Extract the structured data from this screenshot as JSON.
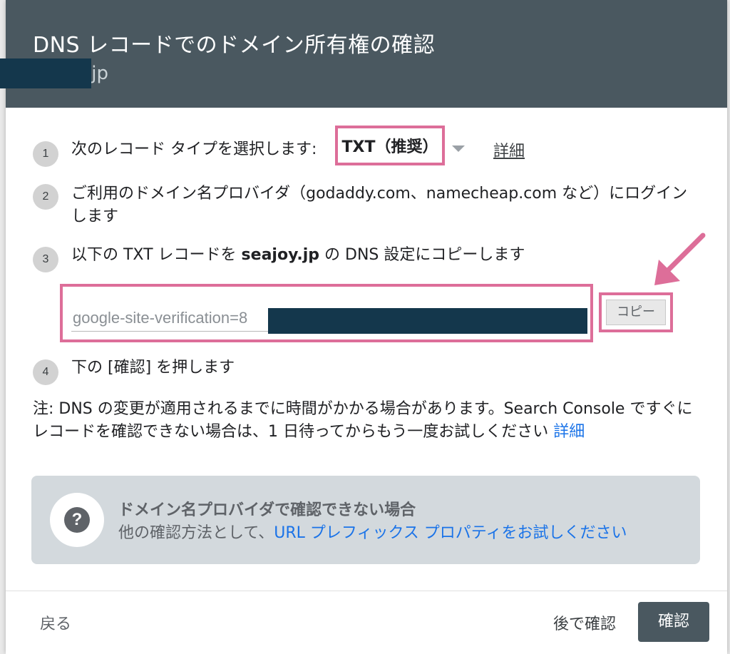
{
  "header": {
    "title": "DNS レコードでのドメイン所有権の確認",
    "domain_suffix": ".jp"
  },
  "steps": [
    {
      "number": "1",
      "text": "次のレコード タイプを選択します:"
    },
    {
      "number": "2",
      "text_line1": "ご利用のドメイン名プロバイダ（godaddy.com、namecheap.com など）にログイン",
      "text_line2": "します"
    },
    {
      "number": "3",
      "text_prefix": "以下の TXT レコードを ",
      "text_domain": "seajoy.jp",
      "text_suffix": " の DNS 設定にコピーします"
    },
    {
      "number": "4",
      "text": "下の [確認] を押します"
    }
  ],
  "record_type": {
    "selected": "TXT（推奨）",
    "details_link": "詳細"
  },
  "record": {
    "value": "google-site-verification=8",
    "copy_label": "コピー"
  },
  "note": {
    "text": "注: DNS の変更が適用されるまでに時間がかかる場合があります。Search Console ですぐにレコードを確認できない場合は、1 日待ってからもう一度お試しください ",
    "link": "詳細"
  },
  "alternative": {
    "title": "ドメイン名プロバイダで確認できない場合",
    "desc_prefix": "他の確認方法として、",
    "desc_link": "URL プレフィックス プロパティをお試しください"
  },
  "footer": {
    "back_label": "戻る",
    "later_label": "後で確認",
    "verify_label": "確認"
  },
  "colors": {
    "header_bg": "#4a5860",
    "highlight": "#dd6e99",
    "link": "#1a73e8",
    "redaction": "#14374c"
  }
}
